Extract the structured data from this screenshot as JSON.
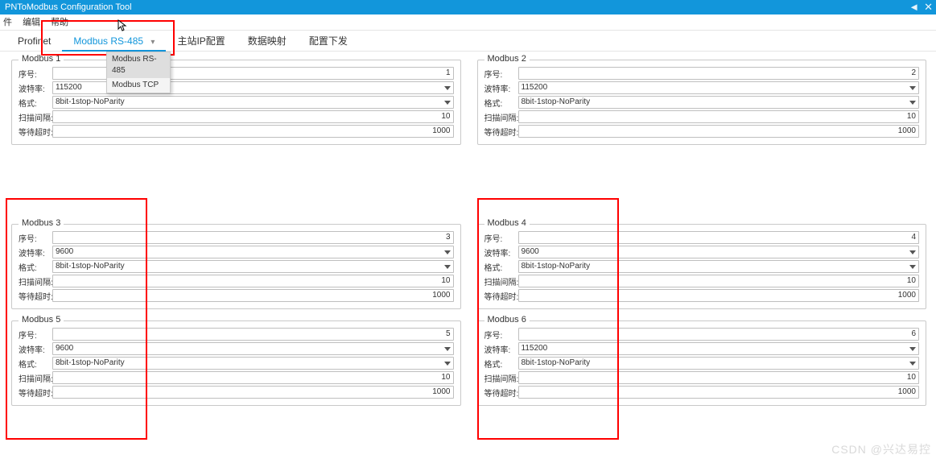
{
  "title": "PNToModbus Configuration Tool",
  "menu": {
    "file": "件",
    "edit": "编辑",
    "help": "帮助"
  },
  "tabs": {
    "items": [
      "Profinet",
      "Modbus RS-485",
      "主站IP配置",
      "数据映射",
      "配置下发"
    ],
    "active_index": 1
  },
  "dropdown": {
    "items": [
      "Modbus RS-485",
      "Modbus TCP"
    ],
    "selected_index": 0
  },
  "labels": {
    "seq": "序号:",
    "baud": "波特率:",
    "format": "格式:",
    "scan": "扫描间隔:",
    "wait": "等待超时:"
  },
  "groups": [
    {
      "title": "Modbus 1",
      "seq": "1",
      "baud": "115200",
      "format": "8bit-1stop-NoParity",
      "scan": "10",
      "wait": "1000"
    },
    {
      "title": "Modbus 2",
      "seq": "2",
      "baud": "115200",
      "format": "8bit-1stop-NoParity",
      "scan": "10",
      "wait": "1000"
    },
    {
      "title": "Modbus 3",
      "seq": "3",
      "baud": "9600",
      "format": "8bit-1stop-NoParity",
      "scan": "10",
      "wait": "1000"
    },
    {
      "title": "Modbus 4",
      "seq": "4",
      "baud": "9600",
      "format": "8bit-1stop-NoParity",
      "scan": "10",
      "wait": "1000"
    },
    {
      "title": "Modbus 5",
      "seq": "5",
      "baud": "9600",
      "format": "8bit-1stop-NoParity",
      "scan": "10",
      "wait": "1000"
    },
    {
      "title": "Modbus 6",
      "seq": "6",
      "baud": "115200",
      "format": "8bit-1stop-NoParity",
      "scan": "10",
      "wait": "1000"
    }
  ],
  "watermark": "CSDN @兴达易控"
}
